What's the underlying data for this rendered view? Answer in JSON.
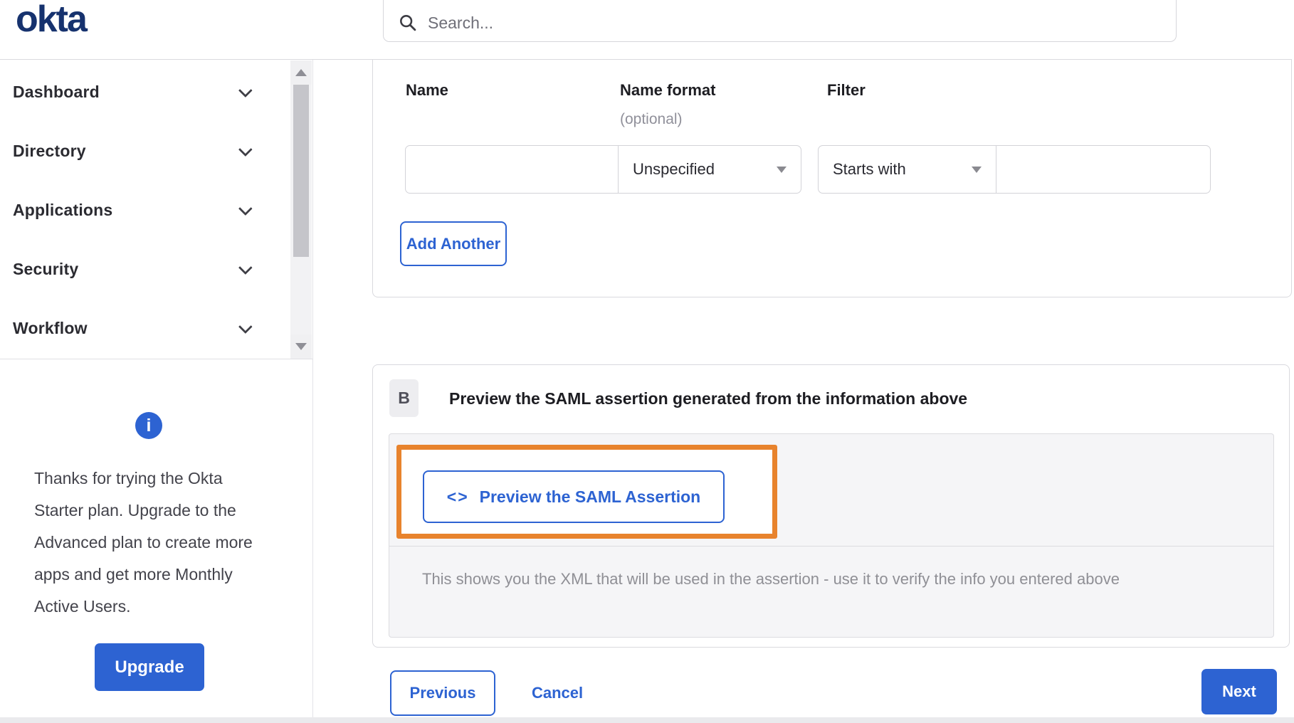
{
  "brand": {
    "logo_text": "okta"
  },
  "search": {
    "placeholder": "Search..."
  },
  "sidebar": {
    "items": [
      {
        "label": "Dashboard"
      },
      {
        "label": "Directory"
      },
      {
        "label": "Applications"
      },
      {
        "label": "Security"
      },
      {
        "label": "Workflow"
      }
    ],
    "upsell": {
      "message": "Thanks for trying the Okta Starter plan. Upgrade to the Advanced plan to create more apps and get more Monthly Active Users.",
      "upgrade_label": "Upgrade"
    }
  },
  "attribute_form": {
    "name_label": "Name",
    "name_format_label": "Name format",
    "name_format_hint": "(optional)",
    "filter_label": "Filter",
    "name_value": "",
    "name_format_value": "Unspecified",
    "filter_op_value": "Starts with",
    "filter_value": "",
    "add_another_label": "Add Another"
  },
  "preview_section": {
    "step_badge": "B",
    "heading": "Preview the SAML assertion generated from the information above",
    "code_icon_glyph": "<>",
    "preview_button_label": "Preview the SAML Assertion",
    "description": "This shows you the XML that will be used in the assertion - use it to verify the info you entered above"
  },
  "wizard_footer": {
    "previous_label": "Previous",
    "cancel_label": "Cancel",
    "next_label": "Next"
  },
  "colors": {
    "accent_blue": "#2d63d2",
    "logo_navy": "#16326e",
    "annotation_orange": "#e8832d",
    "step_badge_bg": "#ededf0"
  }
}
